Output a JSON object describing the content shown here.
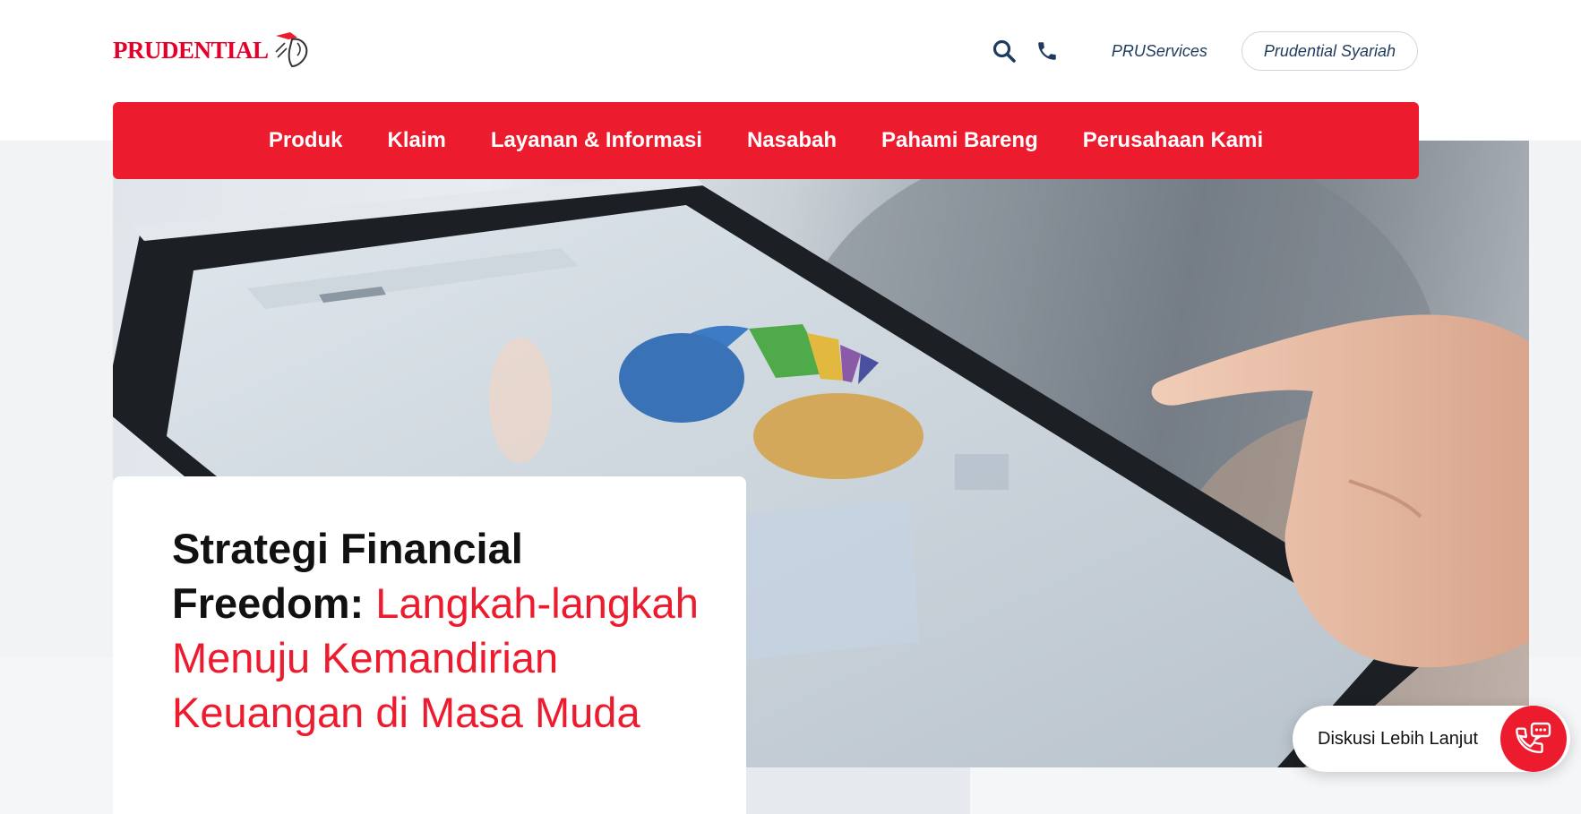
{
  "brand": {
    "name": "PRUDENTIAL",
    "accent_color": "#ed1b2e",
    "navy_color": "#1f3a5c"
  },
  "header": {
    "icons": [
      "search-icon",
      "phone-icon"
    ],
    "pruservices_label": "PRUServices",
    "syariah_label": "Prudential Syariah"
  },
  "nav": {
    "items": [
      {
        "label": "Produk"
      },
      {
        "label": "Klaim"
      },
      {
        "label": "Layanan & Informasi"
      },
      {
        "label": "Nasabah"
      },
      {
        "label": "Pahami Bareng"
      },
      {
        "label": "Perusahaan Kami"
      }
    ]
  },
  "hero": {
    "title_bold": "Strategi Financial Freedom:",
    "title_rest": "Langkah-langkah Menuju Kemandirian Keuangan di Masa Muda"
  },
  "chat": {
    "label": "Diskusi Lebih Lanjut",
    "icon": "chat-phone-icon"
  }
}
